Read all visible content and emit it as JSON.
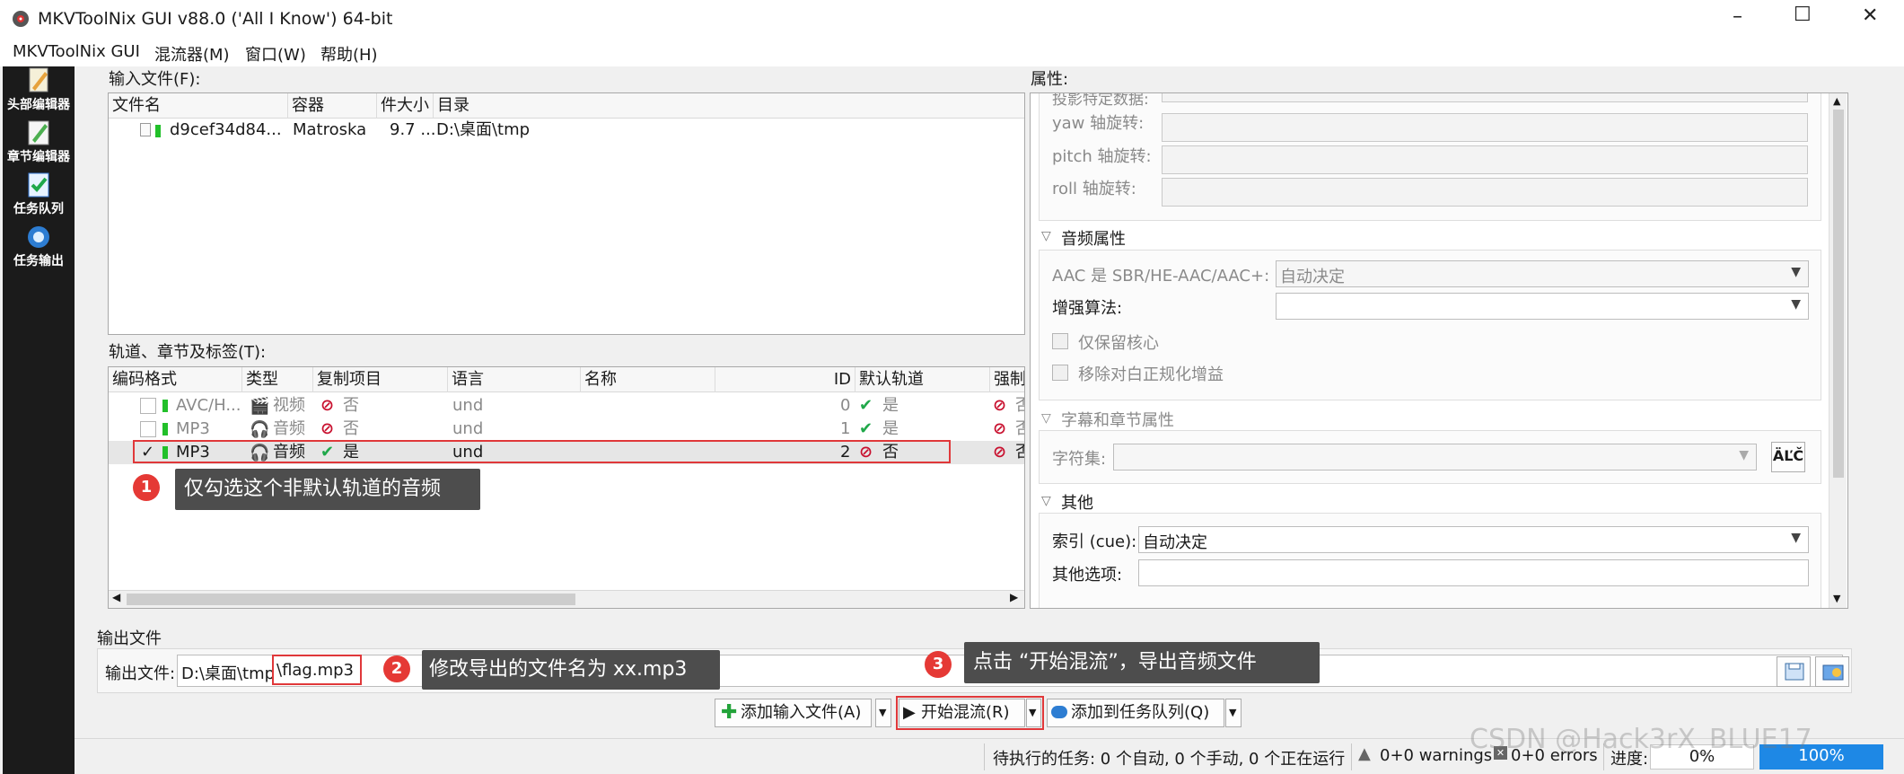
{
  "window": {
    "title": "MKVToolNix GUI v88.0 ('All I Know') 64-bit",
    "controls": [
      "–",
      "☐",
      "✕"
    ]
  },
  "menu": [
    "MKVToolNix GUI",
    "混流器(M)",
    "窗口(W)",
    "帮助(H)"
  ],
  "sidebar": [
    {
      "label": "头部编辑器",
      "icon": "header-editor-icon"
    },
    {
      "label": "章节编辑器",
      "icon": "chapter-editor-icon"
    },
    {
      "label": "任务队列",
      "icon": "job-queue-icon"
    },
    {
      "label": "任务输出",
      "icon": "job-output-icon"
    }
  ],
  "input_files": {
    "label": "输入文件(F):",
    "columns": [
      "文件名",
      "容器",
      "件大小",
      "目录"
    ],
    "rows": [
      {
        "name": "d9cef34d84...",
        "container": "Matroska",
        "size": "9.7 ...",
        "dir": "D:\\桌面\\tmp"
      }
    ]
  },
  "tracks": {
    "label": "轨道、章节及标签(T):",
    "columns": [
      "编码格式",
      "类型",
      "复制项目",
      "语言",
      "名称",
      "ID",
      "默认轨道",
      "强制"
    ],
    "rows": [
      {
        "checked": false,
        "codec": "AVC/H...",
        "type": "视频",
        "copy": "否",
        "lang": "und",
        "name": "",
        "id": "0",
        "default": "是",
        "forced": "否",
        "dim": true
      },
      {
        "checked": false,
        "codec": "MP3",
        "type": "音频",
        "copy": "否",
        "lang": "und",
        "name": "",
        "id": "1",
        "default": "是",
        "forced": "否",
        "dim": true
      },
      {
        "checked": true,
        "check_mark": "✓",
        "codec": "MP3",
        "type": "音频",
        "copy": "是",
        "lang": "und",
        "name": "",
        "id": "2",
        "default": "否",
        "forced": "否",
        "dim": false
      }
    ]
  },
  "properties": {
    "label": "属性:",
    "cut_label": "投影特定数据:",
    "rotation": [
      {
        "label": "yaw 轴旋转:",
        "value": ""
      },
      {
        "label": "pitch 轴旋转:",
        "value": ""
      },
      {
        "label": "roll 轴旋转:",
        "value": ""
      }
    ],
    "audio_group": "音频属性",
    "aac_label": "AAC 是 SBR/HE-AAC/AAC+:",
    "aac_value": "自动决定",
    "enhance_label": "增强算法:",
    "enhance_value": "",
    "core_only": "仅保留核心",
    "remove_dialnorm": "移除对白正规化增益",
    "subtitle_group": "字幕和章节属性",
    "charset_label": "字符集:",
    "charset_value": "",
    "charset_btn": "ÄĽČ",
    "other_group": "其他",
    "cue_label": "索引 (cue):",
    "cue_value": "自动决定",
    "other_opts_label": "其他选项:",
    "other_opts_value": ""
  },
  "output": {
    "section": "输出文件",
    "label": "输出文件:",
    "path_prefix": "D:\\桌面\\tmp",
    "filename": "\\flag.mp3"
  },
  "buttons": {
    "add_input": "添加输入文件(A)",
    "start_mux": "开始混流(R)",
    "add_queue": "添加到任务队列(Q)"
  },
  "annotations": [
    {
      "num": "1",
      "text": "仅勾选这个非默认轨道的音频"
    },
    {
      "num": "2",
      "text": "修改导出的文件名为 xx.mp3"
    },
    {
      "num": "3",
      "text": "点击 “开始混流”，导出音频文件"
    }
  ],
  "status": {
    "pending": "待执行的任务: 0 个自动, 0 个手动, 0 个正在运行",
    "warnings": "0+0 warnings",
    "errors": "0+0 errors",
    "progress_label": "进度:",
    "progress_value": "0%",
    "total_progress": "100%"
  },
  "watermark": "CSDN @Hack3rX_BLUE17"
}
